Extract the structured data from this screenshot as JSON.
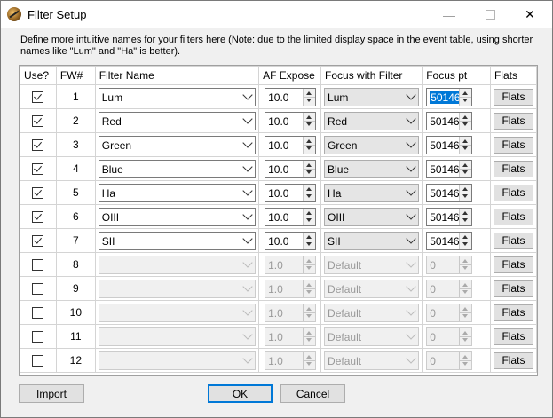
{
  "window": {
    "title": "Filter Setup",
    "icon": "telescope-app-icon",
    "min_glyph": "—",
    "close_glyph": "✕"
  },
  "description": "Define more intuitive names for your filters here (Note: due to the limited display space in the event table, using shorter names like \"Lum\" and \"Ha\" is better).",
  "columns": {
    "use": "Use?",
    "fw": "FW#",
    "name": "Filter Name",
    "af": "AF Expose",
    "focus": "Focus with Filter",
    "pt": "Focus pt",
    "flats": "Flats"
  },
  "rows": [
    {
      "use": true,
      "fw": "1",
      "name": "Lum",
      "af": "10.0",
      "focus": "Lum",
      "pt": "50146",
      "enabled": true,
      "pt_selected": true
    },
    {
      "use": true,
      "fw": "2",
      "name": "Red",
      "af": "10.0",
      "focus": "Red",
      "pt": "50146",
      "enabled": true,
      "pt_selected": false
    },
    {
      "use": true,
      "fw": "3",
      "name": "Green",
      "af": "10.0",
      "focus": "Green",
      "pt": "50146",
      "enabled": true,
      "pt_selected": false
    },
    {
      "use": true,
      "fw": "4",
      "name": "Blue",
      "af": "10.0",
      "focus": "Blue",
      "pt": "50146",
      "enabled": true,
      "pt_selected": false
    },
    {
      "use": true,
      "fw": "5",
      "name": "Ha",
      "af": "10.0",
      "focus": "Ha",
      "pt": "50146",
      "enabled": true,
      "pt_selected": false
    },
    {
      "use": true,
      "fw": "6",
      "name": "OIII",
      "af": "10.0",
      "focus": "OIII",
      "pt": "50146",
      "enabled": true,
      "pt_selected": false
    },
    {
      "use": true,
      "fw": "7",
      "name": "SII",
      "af": "10.0",
      "focus": "SII",
      "pt": "50146",
      "enabled": true,
      "pt_selected": false
    },
    {
      "use": false,
      "fw": "8",
      "name": "",
      "af": "1.0",
      "focus": "Default",
      "pt": "0",
      "enabled": false,
      "pt_selected": false
    },
    {
      "use": false,
      "fw": "9",
      "name": "",
      "af": "1.0",
      "focus": "Default",
      "pt": "0",
      "enabled": false,
      "pt_selected": false
    },
    {
      "use": false,
      "fw": "10",
      "name": "",
      "af": "1.0",
      "focus": "Default",
      "pt": "0",
      "enabled": false,
      "pt_selected": false
    },
    {
      "use": false,
      "fw": "11",
      "name": "",
      "af": "1.0",
      "focus": "Default",
      "pt": "0",
      "enabled": false,
      "pt_selected": false
    },
    {
      "use": false,
      "fw": "12",
      "name": "",
      "af": "1.0",
      "focus": "Default",
      "pt": "0",
      "enabled": false,
      "pt_selected": false
    }
  ],
  "flats_label": "Flats",
  "buttons": {
    "import": "Import",
    "ok": "OK",
    "cancel": "Cancel"
  },
  "colors": {
    "selection": "#0078d7",
    "default_button_border": "#0078d7",
    "window_bg": "#f0f0f0"
  }
}
